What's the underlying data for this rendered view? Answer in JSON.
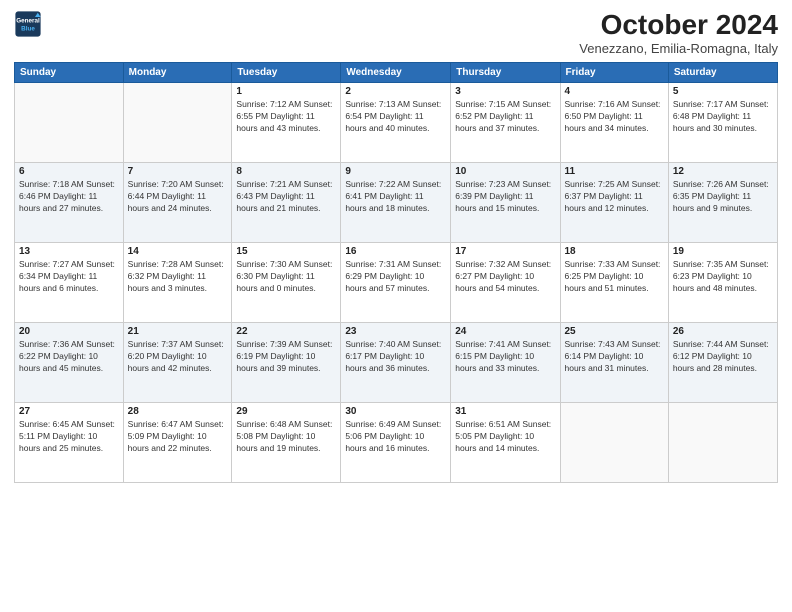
{
  "header": {
    "logo_line1": "General",
    "logo_line2": "Blue",
    "month": "October 2024",
    "location": "Venezzano, Emilia-Romagna, Italy"
  },
  "days_of_week": [
    "Sunday",
    "Monday",
    "Tuesday",
    "Wednesday",
    "Thursday",
    "Friday",
    "Saturday"
  ],
  "weeks": [
    [
      {
        "day": "",
        "info": ""
      },
      {
        "day": "",
        "info": ""
      },
      {
        "day": "1",
        "info": "Sunrise: 7:12 AM\nSunset: 6:55 PM\nDaylight: 11 hours and 43 minutes."
      },
      {
        "day": "2",
        "info": "Sunrise: 7:13 AM\nSunset: 6:54 PM\nDaylight: 11 hours and 40 minutes."
      },
      {
        "day": "3",
        "info": "Sunrise: 7:15 AM\nSunset: 6:52 PM\nDaylight: 11 hours and 37 minutes."
      },
      {
        "day": "4",
        "info": "Sunrise: 7:16 AM\nSunset: 6:50 PM\nDaylight: 11 hours and 34 minutes."
      },
      {
        "day": "5",
        "info": "Sunrise: 7:17 AM\nSunset: 6:48 PM\nDaylight: 11 hours and 30 minutes."
      }
    ],
    [
      {
        "day": "6",
        "info": "Sunrise: 7:18 AM\nSunset: 6:46 PM\nDaylight: 11 hours and 27 minutes."
      },
      {
        "day": "7",
        "info": "Sunrise: 7:20 AM\nSunset: 6:44 PM\nDaylight: 11 hours and 24 minutes."
      },
      {
        "day": "8",
        "info": "Sunrise: 7:21 AM\nSunset: 6:43 PM\nDaylight: 11 hours and 21 minutes."
      },
      {
        "day": "9",
        "info": "Sunrise: 7:22 AM\nSunset: 6:41 PM\nDaylight: 11 hours and 18 minutes."
      },
      {
        "day": "10",
        "info": "Sunrise: 7:23 AM\nSunset: 6:39 PM\nDaylight: 11 hours and 15 minutes."
      },
      {
        "day": "11",
        "info": "Sunrise: 7:25 AM\nSunset: 6:37 PM\nDaylight: 11 hours and 12 minutes."
      },
      {
        "day": "12",
        "info": "Sunrise: 7:26 AM\nSunset: 6:35 PM\nDaylight: 11 hours and 9 minutes."
      }
    ],
    [
      {
        "day": "13",
        "info": "Sunrise: 7:27 AM\nSunset: 6:34 PM\nDaylight: 11 hours and 6 minutes."
      },
      {
        "day": "14",
        "info": "Sunrise: 7:28 AM\nSunset: 6:32 PM\nDaylight: 11 hours and 3 minutes."
      },
      {
        "day": "15",
        "info": "Sunrise: 7:30 AM\nSunset: 6:30 PM\nDaylight: 11 hours and 0 minutes."
      },
      {
        "day": "16",
        "info": "Sunrise: 7:31 AM\nSunset: 6:29 PM\nDaylight: 10 hours and 57 minutes."
      },
      {
        "day": "17",
        "info": "Sunrise: 7:32 AM\nSunset: 6:27 PM\nDaylight: 10 hours and 54 minutes."
      },
      {
        "day": "18",
        "info": "Sunrise: 7:33 AM\nSunset: 6:25 PM\nDaylight: 10 hours and 51 minutes."
      },
      {
        "day": "19",
        "info": "Sunrise: 7:35 AM\nSunset: 6:23 PM\nDaylight: 10 hours and 48 minutes."
      }
    ],
    [
      {
        "day": "20",
        "info": "Sunrise: 7:36 AM\nSunset: 6:22 PM\nDaylight: 10 hours and 45 minutes."
      },
      {
        "day": "21",
        "info": "Sunrise: 7:37 AM\nSunset: 6:20 PM\nDaylight: 10 hours and 42 minutes."
      },
      {
        "day": "22",
        "info": "Sunrise: 7:39 AM\nSunset: 6:19 PM\nDaylight: 10 hours and 39 minutes."
      },
      {
        "day": "23",
        "info": "Sunrise: 7:40 AM\nSunset: 6:17 PM\nDaylight: 10 hours and 36 minutes."
      },
      {
        "day": "24",
        "info": "Sunrise: 7:41 AM\nSunset: 6:15 PM\nDaylight: 10 hours and 33 minutes."
      },
      {
        "day": "25",
        "info": "Sunrise: 7:43 AM\nSunset: 6:14 PM\nDaylight: 10 hours and 31 minutes."
      },
      {
        "day": "26",
        "info": "Sunrise: 7:44 AM\nSunset: 6:12 PM\nDaylight: 10 hours and 28 minutes."
      }
    ],
    [
      {
        "day": "27",
        "info": "Sunrise: 6:45 AM\nSunset: 5:11 PM\nDaylight: 10 hours and 25 minutes."
      },
      {
        "day": "28",
        "info": "Sunrise: 6:47 AM\nSunset: 5:09 PM\nDaylight: 10 hours and 22 minutes."
      },
      {
        "day": "29",
        "info": "Sunrise: 6:48 AM\nSunset: 5:08 PM\nDaylight: 10 hours and 19 minutes."
      },
      {
        "day": "30",
        "info": "Sunrise: 6:49 AM\nSunset: 5:06 PM\nDaylight: 10 hours and 16 minutes."
      },
      {
        "day": "31",
        "info": "Sunrise: 6:51 AM\nSunset: 5:05 PM\nDaylight: 10 hours and 14 minutes."
      },
      {
        "day": "",
        "info": ""
      },
      {
        "day": "",
        "info": ""
      }
    ]
  ]
}
